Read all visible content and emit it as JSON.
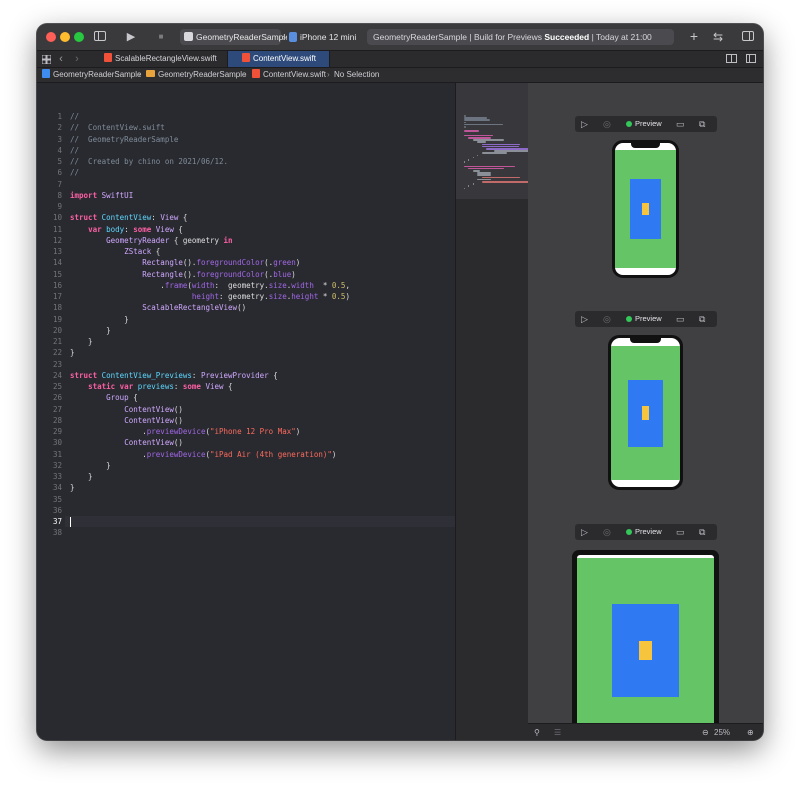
{
  "toolbar": {
    "scheme_project": "GeometryReaderSample",
    "scheme_device": "iPhone 12 mini",
    "activity_prefix": "GeometryReaderSample | Build for Previews ",
    "activity_status": "Succeeded",
    "activity_time": " | Today at 21:00",
    "run_icon": "▶",
    "stop_icon": "■",
    "add_icon": "+",
    "swap_icon": "⇆"
  },
  "tabs": [
    {
      "label": "ScalableRectangleView.swift",
      "active": false
    },
    {
      "label": "ContentView.swift",
      "active": true
    }
  ],
  "jumpbar": {
    "project": "GeometryReaderSample",
    "folder": "GeometryReaderSample",
    "file": "ContentView.swift",
    "selection": "No Selection",
    "separator": "›"
  },
  "editor": {
    "current_line": 37,
    "lines": [
      "//",
      "//  ContentView.swift",
      "//  GeometryReaderSample",
      "//",
      "//  Created by chino on 2021/06/12.",
      "//",
      "",
      "import SwiftUI",
      "",
      "struct ContentView: View {",
      "    var body: some View {",
      "        GeometryReader { geometry in",
      "            ZStack {",
      "                Rectangle().foregroundColor(.green)",
      "                Rectangle().foregroundColor(.blue)",
      "                    .frame(width:  geometry.size.width  * 0.5,",
      "                           height: geometry.size.height * 0.5)",
      "                ScalableRectangleView()",
      "            }",
      "        }",
      "    }",
      "}",
      "",
      "struct ContentView_Previews: PreviewProvider {",
      "    static var previews: some View {",
      "        Group {",
      "            ContentView()",
      "            ContentView()",
      "                .previewDevice(\"iPhone 12 Pro Max\")",
      "            ContentView()",
      "                .previewDevice(\"iPad Air (4th generation)\")",
      "        }",
      "    }",
      "}",
      "",
      "",
      "",
      ""
    ]
  },
  "preview": {
    "label": "Preview",
    "zoom": "25%",
    "device_count": 3
  },
  "colors": {
    "green": "#64c466",
    "blue": "#2f79f2",
    "yellow": "#f7c53d",
    "live_dot": "#34c759"
  }
}
